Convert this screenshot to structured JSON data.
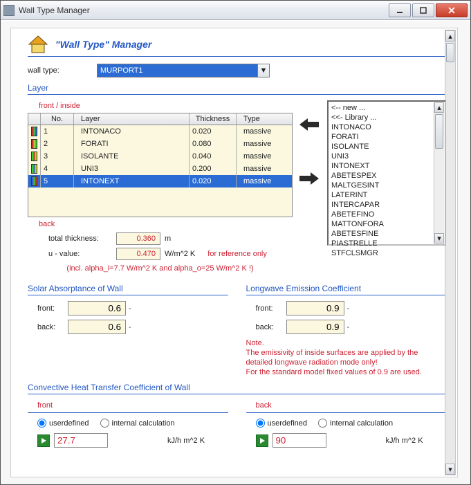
{
  "window": {
    "title": "Wall Type Manager"
  },
  "header": {
    "title": "\"Wall Type\" Manager"
  },
  "walltype": {
    "label": "wall type:",
    "value": "MURPORT1"
  },
  "layer": {
    "section": "Layer",
    "front_label": "front / inside",
    "back_label": "back",
    "columns": {
      "no": "No.",
      "layer": "Layer",
      "thick": "Thickness",
      "type": "Type"
    },
    "rows": [
      {
        "no": "1",
        "layer": "INTONACO",
        "thick": "0.020",
        "type": "massive"
      },
      {
        "no": "2",
        "layer": "FORATI",
        "thick": "0.080",
        "type": "massive"
      },
      {
        "no": "3",
        "layer": "ISOLANTE",
        "thick": "0.040",
        "type": "massive"
      },
      {
        "no": "4",
        "layer": "UNI3",
        "thick": "0.200",
        "type": "massive"
      },
      {
        "no": "5",
        "layer": "INTONEXT",
        "thick": "0.020",
        "type": "massive"
      }
    ],
    "totals": {
      "total_label": "total thickness:",
      "total_val": "0.360",
      "total_unit": "m",
      "u_label": "u - value:",
      "u_val": "0.470",
      "u_unit": "W/m^2 K",
      "ref": "for reference only",
      "incl": "(incl. alpha_i=7.7 W/m^2 K and alpha_o=25 W/m^2 K !)"
    },
    "library": [
      "<-- new ...",
      "<<- Library ...",
      "INTONACO",
      "FORATI",
      "ISOLANTE",
      "UNI3",
      "INTONEXT",
      "ABETESPEX",
      "MALTGESINT",
      "LATERINT",
      "INTERCAPAR",
      "ABETEFINO",
      "MATTONFORA",
      "ABETESFINE",
      "PIASTRELLE",
      "STFCLSMGR"
    ]
  },
  "solar": {
    "title": "Solar Absorptance of Wall",
    "front_label": "front:",
    "front_val": "0.6",
    "back_label": "back:",
    "back_val": "0.6"
  },
  "longwave": {
    "title": "Longwave Emission Coefficient",
    "front_label": "front:",
    "front_val": "0.9",
    "back_label": "back:",
    "back_val": "0.9",
    "note_title": "Note.",
    "note1": "The emissivity of inside surfaces are applied by the detailed longwave radiation mode only!",
    "note2": "For the standard model fixed values of 0.9 are used."
  },
  "convective": {
    "title": "Convective Heat Transfer Coefficient of Wall",
    "front_label": "front",
    "back_label": "back",
    "opt_user": "userdefined",
    "opt_int": "internal calculation",
    "front_val": "27.7",
    "back_val": "90",
    "unit": "kJ/h m^2 K"
  }
}
